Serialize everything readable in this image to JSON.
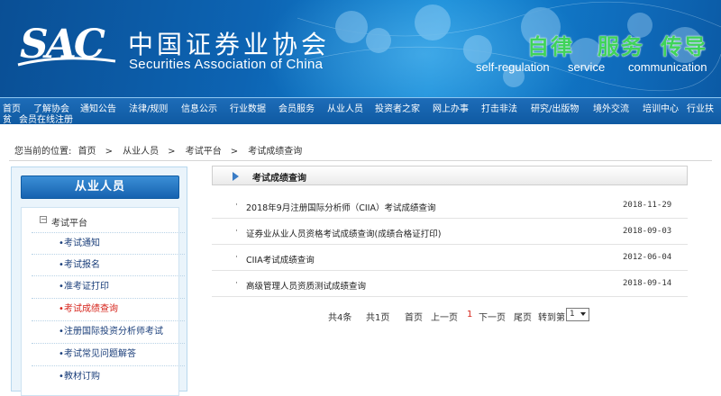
{
  "header": {
    "logo_text": "SAC",
    "org_cn": "中国证券业协会",
    "org_en": "Securities Association of China",
    "motto": [
      {
        "cn": "自律",
        "en": "self-regulation"
      },
      {
        "cn": "服务",
        "en": "service"
      },
      {
        "cn": "传导",
        "en": "communication"
      }
    ],
    "colors": {
      "banner": "#0d64b3",
      "nav": "#1662b0",
      "motto_green": "#3fd35a",
      "active_red": "#d6241b"
    }
  },
  "nav": {
    "items": [
      "首页",
      "了解协会",
      "通知公告",
      "法律/规则",
      "信息公示",
      "行业数据",
      "会员服务",
      "从业人员",
      "投资者之家",
      "网上办事",
      "打击非法",
      "研究/出版物",
      "境外交流",
      "培训中心",
      "行业扶",
      "贫",
      "会员在线注册"
    ]
  },
  "breadcrumb": {
    "prefix": "您当前的位置:",
    "items": [
      "首页",
      "从业人员",
      "考试平台",
      "考试成绩查询"
    ],
    "separator": ">"
  },
  "sidebar": {
    "title": "从业人员",
    "group": "考试平台",
    "items": [
      {
        "label": "考试通知",
        "active": false
      },
      {
        "label": "考试报名",
        "active": false
      },
      {
        "label": "准考证打印",
        "active": false
      },
      {
        "label": "考试成绩查询",
        "active": true
      },
      {
        "label": "注册国际投资分析师考试",
        "active": false
      },
      {
        "label": "考试常见问题解答",
        "active": false
      },
      {
        "label": "教材订购",
        "active": false
      }
    ]
  },
  "content": {
    "title": "考试成绩查询",
    "bullet": "·",
    "rows": [
      {
        "title": "2018年9月注册国际分析师（CIIA）考试成绩查询",
        "date": "2018-11-29"
      },
      {
        "title": "证券业从业人员资格考试成绩查询(成绩合格证打印)",
        "date": "2018-09-03"
      },
      {
        "title": "CIIA考试成绩查询",
        "date": "2012-06-04"
      },
      {
        "title": "高级管理人员资质测试成绩查询",
        "date": "2018-09-14"
      }
    ],
    "pager": {
      "total": "共4条",
      "pages": "共1页",
      "first": "首页",
      "prev": "上一页",
      "current": "1",
      "next": "下一页",
      "last": "尾页",
      "goto": "转到第",
      "select_value": "1"
    }
  }
}
